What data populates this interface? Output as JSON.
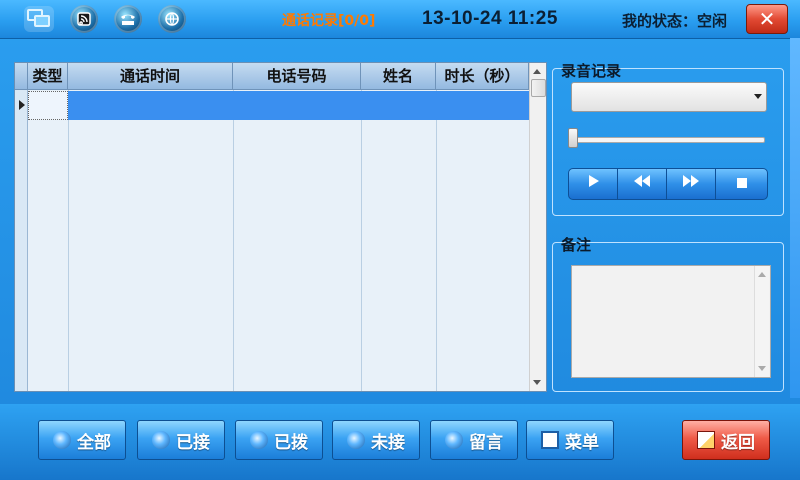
{
  "titlebar": {
    "title": "通话记录[0/0]",
    "datetime": "13-10-24 11:25",
    "status": "我的状态：空闲",
    "close": "✕",
    "icons": [
      "network-icon",
      "rss-icon",
      "phone-icon",
      "globe-icon"
    ]
  },
  "table": {
    "columns": [
      "类型",
      "通话时间",
      "电话号码",
      "姓名",
      "时长（秒）"
    ],
    "rows": []
  },
  "recording": {
    "label": "录音记录",
    "selected": "",
    "progress": 0,
    "controls": [
      "play-icon",
      "rewind-icon",
      "fast-forward-icon",
      "stop-icon"
    ]
  },
  "notes": {
    "label": "备注",
    "text": ""
  },
  "buttons": {
    "all": "全部",
    "received": "已接",
    "dialed": "已拨",
    "missed": "未接",
    "voicemail": "留言",
    "menu": "菜单",
    "back": "返回"
  },
  "colors": {
    "accent": "#2b9ff0",
    "title_text": "#ff7a00",
    "selection": "#3a8ff0",
    "close_red": "#e24a34"
  }
}
